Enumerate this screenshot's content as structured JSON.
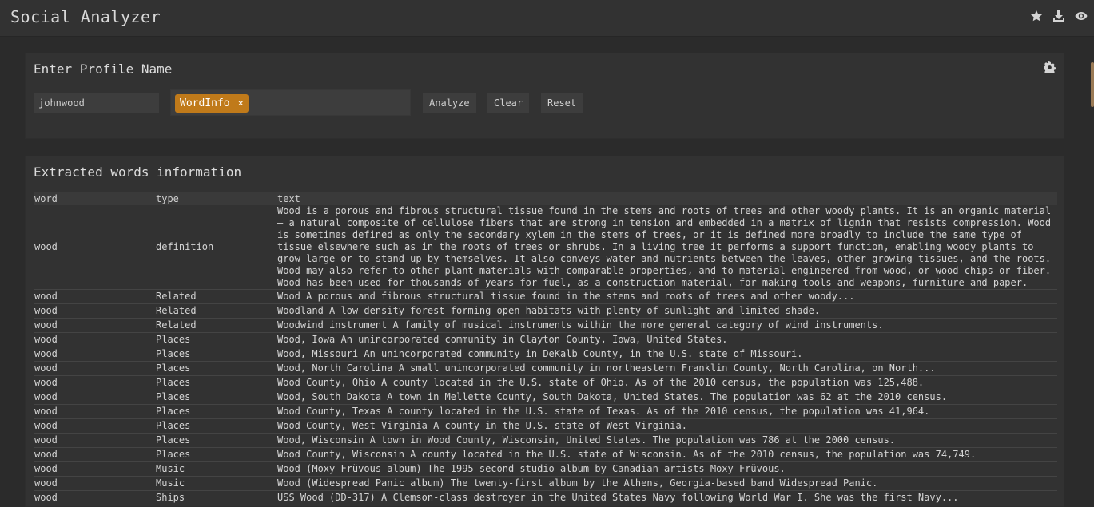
{
  "app": {
    "title": "Social Analyzer",
    "icons": [
      "star-icon",
      "download-icon",
      "eye-icon"
    ]
  },
  "profile": {
    "title": "Enter Profile Name",
    "input_value": "johnwood",
    "tag_label": "WordInfo",
    "tag_remove": "×",
    "analyze_label": "Analyze",
    "clear_label": "Clear",
    "reset_label": "Reset"
  },
  "words": {
    "title": "Extracted words information",
    "columns": [
      "word",
      "type",
      "text"
    ],
    "rows": [
      {
        "word": "wood",
        "type": "definition",
        "text": "Wood is a porous and fibrous structural tissue found in the stems and roots of trees and other woody plants. It is an organic material — a natural composite of cellulose fibers that are strong in tension and embedded in a matrix of lignin that resists compression. Wood is sometimes defined as only the secondary xylem in the stems of trees, or it is defined more broadly to include the same type of tissue elsewhere such as in the roots of trees or shrubs. In a living tree it performs a support function, enabling woody plants to grow large or to stand up by themselves. It also conveys water and nutrients between the leaves, other growing tissues, and the roots. Wood may also refer to other plant materials with comparable properties, and to material engineered from wood, or wood chips or fiber. Wood has been used for thousands of years for fuel, as a construction material, for making tools and weapons, furniture and paper."
      },
      {
        "word": "wood",
        "type": "Related",
        "text": "Wood A porous and fibrous structural tissue found in the stems and roots of trees and other woody..."
      },
      {
        "word": "wood",
        "type": "Related",
        "text": "Woodland A low-density forest forming open habitats with plenty of sunlight and limited shade."
      },
      {
        "word": "wood",
        "type": "Related",
        "text": "Woodwind instrument A family of musical instruments within the more general category of wind instruments."
      },
      {
        "word": "wood",
        "type": "Places",
        "text": "Wood, Iowa An unincorporated community in Clayton County, Iowa, United States."
      },
      {
        "word": "wood",
        "type": "Places",
        "text": "Wood, Missouri An unincorporated community in DeKalb County, in the U.S. state of Missouri."
      },
      {
        "word": "wood",
        "type": "Places",
        "text": "Wood, North Carolina A small unincorporated community in northeastern Franklin County, North Carolina, on North..."
      },
      {
        "word": "wood",
        "type": "Places",
        "text": "Wood County, Ohio A county located in the U.S. state of Ohio. As of the 2010 census, the population was 125,488."
      },
      {
        "word": "wood",
        "type": "Places",
        "text": "Wood, South Dakota A town in Mellette County, South Dakota, United States. The population was 62 at the 2010 census."
      },
      {
        "word": "wood",
        "type": "Places",
        "text": "Wood County, Texas A county located in the U.S. state of Texas. As of the 2010 census, the population was 41,964."
      },
      {
        "word": "wood",
        "type": "Places",
        "text": "Wood County, West Virginia A county in the U.S. state of West Virginia."
      },
      {
        "word": "wood",
        "type": "Places",
        "text": "Wood, Wisconsin A town in Wood County, Wisconsin, United States. The population was 786 at the 2000 census."
      },
      {
        "word": "wood",
        "type": "Places",
        "text": "Wood County, Wisconsin A county located in the U.S. state of Wisconsin. As of the 2010 census, the population was 74,749."
      },
      {
        "word": "wood",
        "type": "Music",
        "text": "Wood (Moxy Früvous album) The 1995 second studio album by Canadian artists Moxy Früvous."
      },
      {
        "word": "wood",
        "type": "Music",
        "text": "Wood (Widespread Panic album) The twenty-first album by the Athens, Georgia-based band Widespread Panic."
      },
      {
        "word": "wood",
        "type": "Ships",
        "text": "USS Wood (DD-317) A Clemson-class destroyer in the United States Navy following World War I. She was the first Navy..."
      }
    ]
  },
  "colors": {
    "background": "#2b2b2b",
    "panel": "#323232",
    "tag": "#c07a1a",
    "text": "#d4d4d4"
  }
}
